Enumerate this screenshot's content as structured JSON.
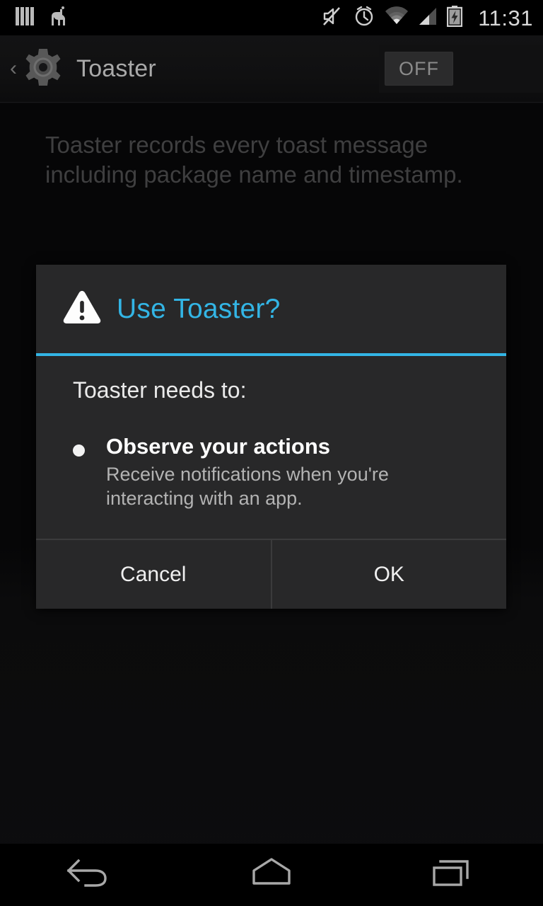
{
  "status_bar": {
    "left_icons": [
      {
        "name": "bars-notification-icon",
        "glyph": "bars"
      },
      {
        "name": "llama-notification-icon",
        "glyph": "llama"
      }
    ],
    "right_icons": [
      {
        "name": "volume-muted-icon",
        "glyph": "mute"
      },
      {
        "name": "alarm-clock-icon",
        "glyph": "alarm"
      },
      {
        "name": "wifi-icon",
        "glyph": "wifi"
      },
      {
        "name": "cellular-signal-icon",
        "glyph": "signal"
      },
      {
        "name": "battery-charging-icon",
        "glyph": "battery"
      }
    ],
    "clock": "11:31"
  },
  "action_bar": {
    "back_chevron": "‹",
    "app_icon": "gear-icon",
    "title": "Toaster",
    "power_switch": {
      "label": "OFF",
      "state": "off"
    }
  },
  "main": {
    "description": "Toaster records every toast message including package name and timestamp."
  },
  "dialog": {
    "icon": "warning-triangle-icon",
    "title": "Use Toaster?",
    "accent_color": "#33b5e5",
    "body_heading": "Toaster needs to:",
    "permissions": [
      {
        "title": "Observe your actions",
        "description": "Receive notifications when you're interacting with an app."
      }
    ],
    "buttons": {
      "cancel": "Cancel",
      "ok": "OK"
    }
  },
  "nav_bar": {
    "back": "back-icon",
    "home": "home-icon",
    "recents": "recents-icon"
  }
}
